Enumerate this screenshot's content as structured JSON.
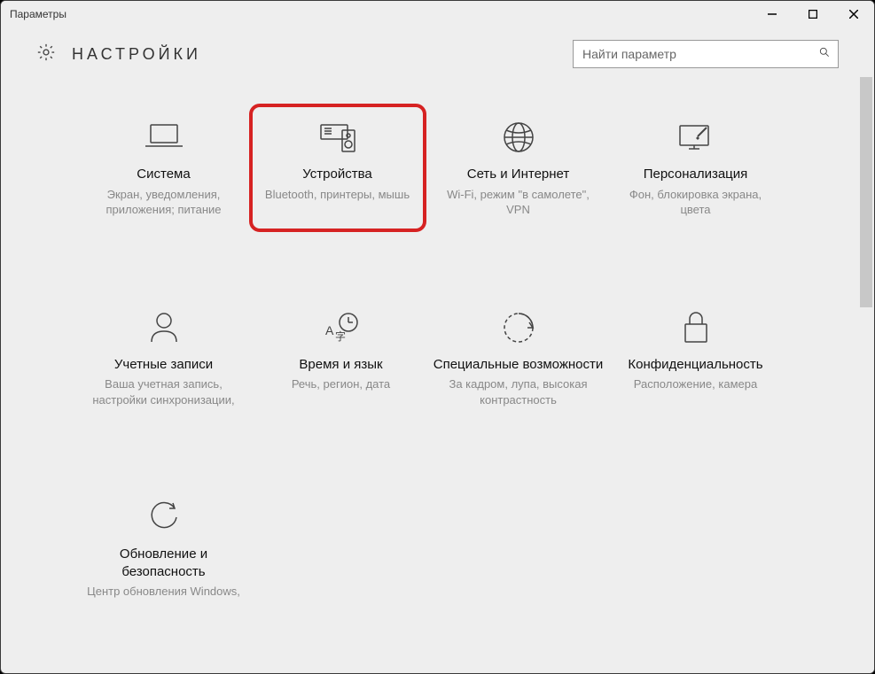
{
  "window": {
    "title": "Параметры"
  },
  "header": {
    "page_title": "НАСТРОЙКИ",
    "search_placeholder": "Найти параметр"
  },
  "tiles": [
    {
      "title": "Система",
      "desc": "Экран, уведомления, приложения; питание"
    },
    {
      "title": "Устройства",
      "desc": "Bluetooth, принтеры, мышь"
    },
    {
      "title": "Сеть и Интернет",
      "desc": "Wi-Fi, режим \"в самолете\", VPN"
    },
    {
      "title": "Персонализация",
      "desc": "Фон, блокировка экрана, цвета"
    },
    {
      "title": "Учетные записи",
      "desc": "Ваша учетная запись, настройки синхронизации,"
    },
    {
      "title": "Время и язык",
      "desc": "Речь, регион, дата"
    },
    {
      "title": "Специальные возможности",
      "desc": "За кадром, лупа, высокая контрастность"
    },
    {
      "title": "Конфиденциальность",
      "desc": "Расположение, камера"
    },
    {
      "title": "Обновление и безопасность",
      "desc": "Центр обновления Windows,"
    }
  ]
}
